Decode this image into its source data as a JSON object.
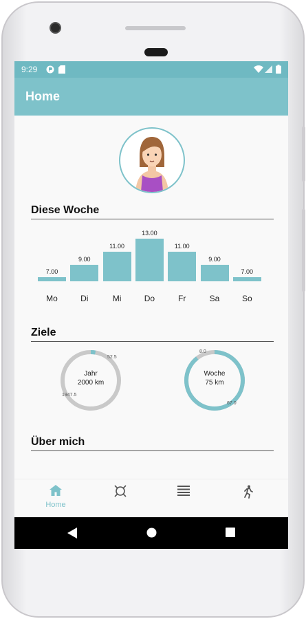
{
  "status_bar": {
    "time": "9:29"
  },
  "app_bar": {
    "title": "Home"
  },
  "sections": {
    "week": "Diese Woche",
    "goals": "Ziele",
    "about": "Über mich"
  },
  "chart_data": {
    "type": "bar",
    "title": "Diese Woche",
    "categories": [
      "Mo",
      "Di",
      "Mi",
      "Do",
      "Fr",
      "Sa",
      "So"
    ],
    "values": [
      7.0,
      9.0,
      11.0,
      13.0,
      11.0,
      9.0,
      7.0
    ],
    "value_labels": [
      "7.00",
      "9.00",
      "11.00",
      "13.00",
      "11.00",
      "9.00",
      "7.00"
    ],
    "color": "#7ec2ca"
  },
  "goals": [
    {
      "title": "Jahr",
      "target": "2000 km",
      "done_label": "52.5",
      "remaining_label": "1947.5",
      "progress": 0.026
    },
    {
      "title": "Woche",
      "target": "75 km",
      "done_label": "67.0",
      "remaining_label": "8.0",
      "progress": 0.893
    }
  ],
  "bottom_nav": {
    "items": [
      {
        "name": "home",
        "label": "Home",
        "icon": "home-icon",
        "active": true
      },
      {
        "name": "goals",
        "label": "",
        "icon": "target-icon",
        "active": false
      },
      {
        "name": "list",
        "label": "",
        "icon": "list-icon",
        "active": false
      },
      {
        "name": "run",
        "label": "",
        "icon": "runner-icon",
        "active": false
      }
    ]
  },
  "colors": {
    "accent": "#7ec2ca",
    "status_bar": "#6fb9c2",
    "ring_track": "#c9c9c9"
  }
}
